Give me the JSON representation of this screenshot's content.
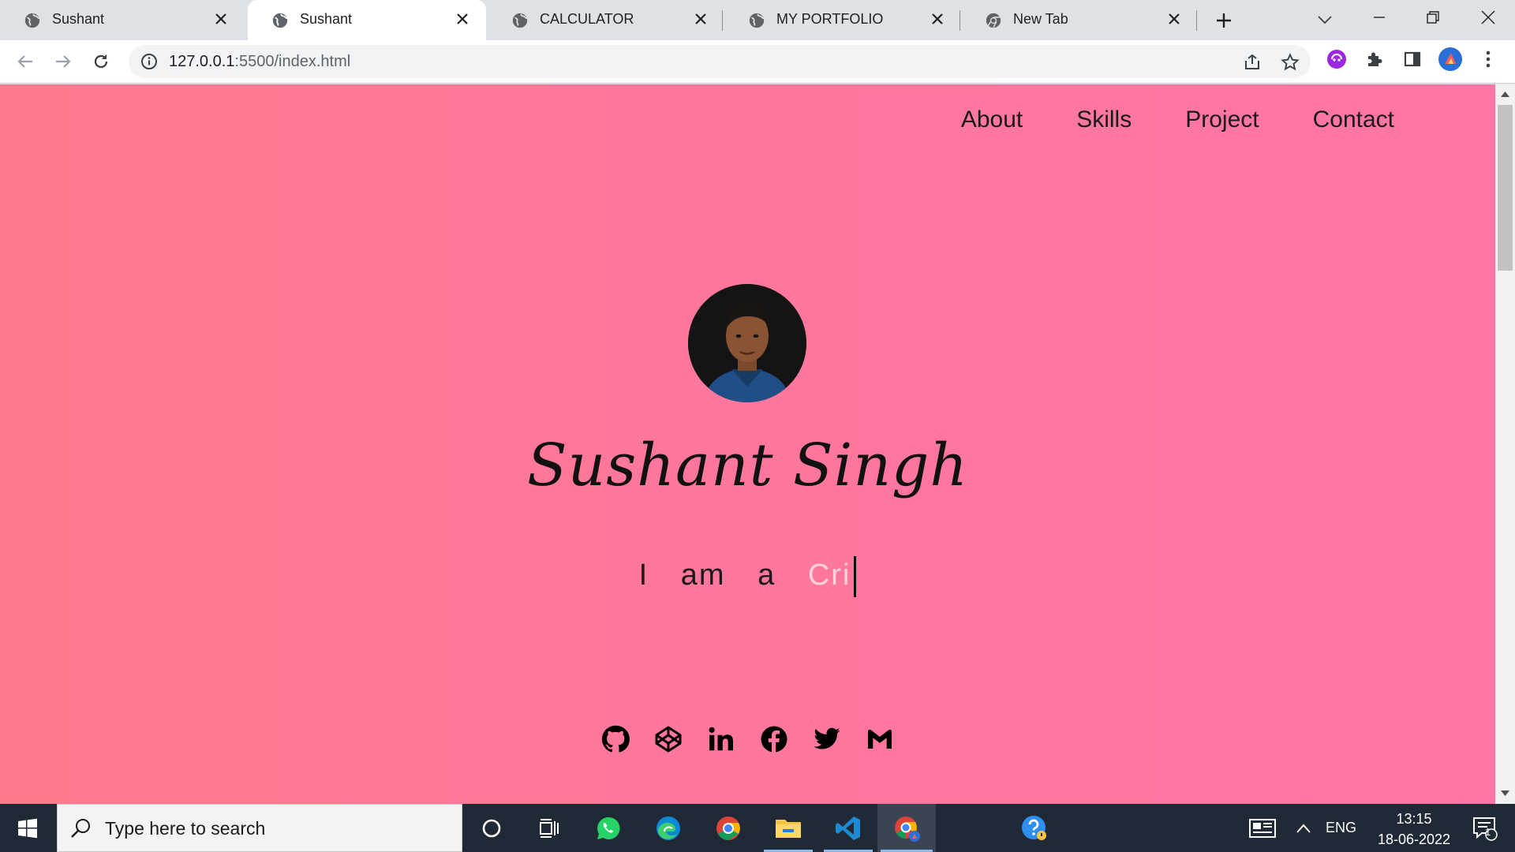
{
  "browser": {
    "tabs": [
      {
        "title": "Sushant",
        "favicon": "globe-icon",
        "active": false
      },
      {
        "title": "Sushant",
        "favicon": "globe-icon",
        "active": true
      },
      {
        "title": "CALCULATOR",
        "favicon": "globe-icon",
        "active": false
      },
      {
        "title": "MY PORTFOLIO",
        "favicon": "globe-icon",
        "active": false
      },
      {
        "title": "New Tab",
        "favicon": "chrome-icon",
        "active": false
      }
    ],
    "url_host": "127.0.0.1",
    "url_path": ":5500/index.html"
  },
  "page": {
    "nav": [
      "About",
      "Skills",
      "Project",
      "Contact"
    ],
    "name": "Sushant Singh",
    "typed_prefix": "I am a",
    "typed_word": "Cri",
    "social": [
      "github-icon",
      "codepen-icon",
      "linkedin-icon",
      "facebook-icon",
      "twitter-icon",
      "gmail-icon"
    ],
    "colors": {
      "gradient_start": "#ff7a8e",
      "gradient_end": "#ff76a6",
      "typed_word": "#ffd1dc"
    }
  },
  "taskbar": {
    "search_placeholder": "Type here to search",
    "language": "ENG",
    "time": "13:15",
    "date": "18-06-2022",
    "notification_count": "1",
    "apps": [
      "cortana-icon",
      "task-view-icon",
      "whatsapp-icon",
      "edge-icon",
      "chrome-icon",
      "file-explorer-icon",
      "vscode-icon",
      "chrome-profile-icon",
      "help-icon"
    ]
  }
}
